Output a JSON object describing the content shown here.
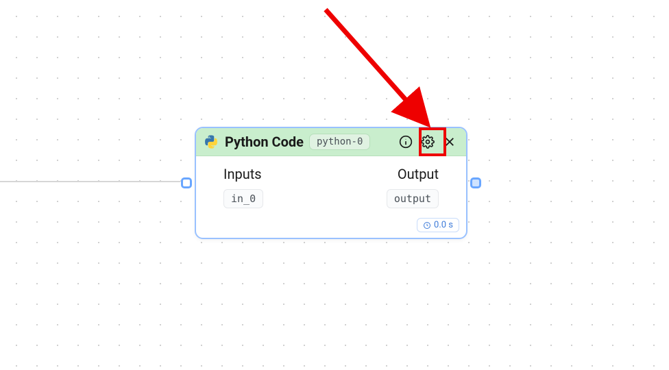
{
  "node": {
    "title": "Python Code",
    "id_badge": "python-0",
    "inputs_heading": "Inputs",
    "output_heading": "Output",
    "input_ports": [
      "in_0"
    ],
    "output_ports": [
      "output"
    ],
    "exec_time": "0.0 s"
  },
  "icons": {
    "language": "python-icon",
    "info": "info-icon",
    "settings": "gear-icon",
    "close": "close-icon",
    "clock": "clock-icon"
  },
  "annotation": {
    "highlight_target": "settings-button",
    "arrow_color": "#ee0000"
  }
}
